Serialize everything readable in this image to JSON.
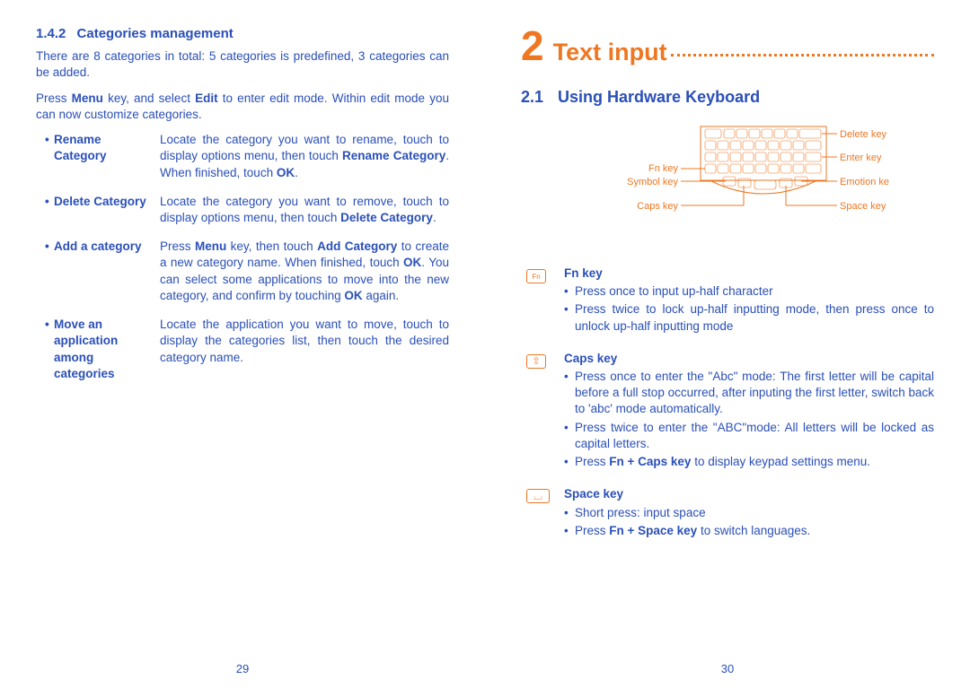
{
  "left": {
    "heading_num": "1.4.2",
    "heading": "Categories management",
    "p1": "There are 8 categories in total: 5 categories is predefined, 3 categories can be added.",
    "p2_pre": "Press ",
    "p2_b1": "Menu",
    "p2_mid": " key, and select ",
    "p2_b2": "Edit",
    "p2_post": " to enter edit mode. Within edit mode you can now customize categories.",
    "items": {
      "rename": {
        "label": "Rename Category",
        "t1": "Locate the category you want to rename, touch to display options menu, then touch ",
        "b1": "Rename Category",
        "t2": ". When finished, touch ",
        "b2": "OK",
        "t3": "."
      },
      "delete": {
        "label": "Delete Category",
        "t1": "Locate the category you want to remove, touch to display options menu, then touch ",
        "b1": "Delete Category",
        "t2": "."
      },
      "add": {
        "label": "Add a category",
        "t1": "Press ",
        "b1": "Menu",
        "t2": " key, then touch ",
        "b2": "Add Category",
        "t3": " to create a new category name. When finished, touch ",
        "b3": "OK",
        "t4": ". You can select some applications to move into the new category, and confirm by touching ",
        "b4": "OK",
        "t5": " again."
      },
      "move": {
        "label": "Move an application among categories",
        "t1": "Locate the application you want to move, touch to display the categories list, then touch the desired category name."
      }
    },
    "page": "29"
  },
  "right": {
    "chapnum": "2",
    "chaptitle": "Text input",
    "secnum": "2.1",
    "sectitle": "Using Hardware Keyboard",
    "labels": {
      "fn": "Fn key",
      "symbol": "Symbol key",
      "caps": "Caps key",
      "delete": "Delete key",
      "enter": "Enter key",
      "emotion": "Emotion key",
      "space": "Space key"
    },
    "fn": {
      "title": "Fn key",
      "i1": "Press once to input up-half character",
      "i2": "Press twice to lock up-half inputting mode, then press once to unlock up-half inputting mode"
    },
    "caps": {
      "title": "Caps key",
      "i1": "Press once to enter the \"Abc\" mode: The first letter will be capital before a full stop occurred, after inputing the first letter, switch back to 'abc' mode automatically.",
      "i2": "Press twice to enter the \"ABC\"mode: All letters will be locked as capital letters.",
      "i3a": "Press ",
      "i3b": "Fn + Caps key",
      "i3c": " to display keypad settings menu."
    },
    "space": {
      "title": "Space key",
      "i1": "Short press: input space",
      "i2a": "Press ",
      "i2b": "Fn + Space key",
      "i2c": " to switch languages."
    },
    "page": "30"
  }
}
